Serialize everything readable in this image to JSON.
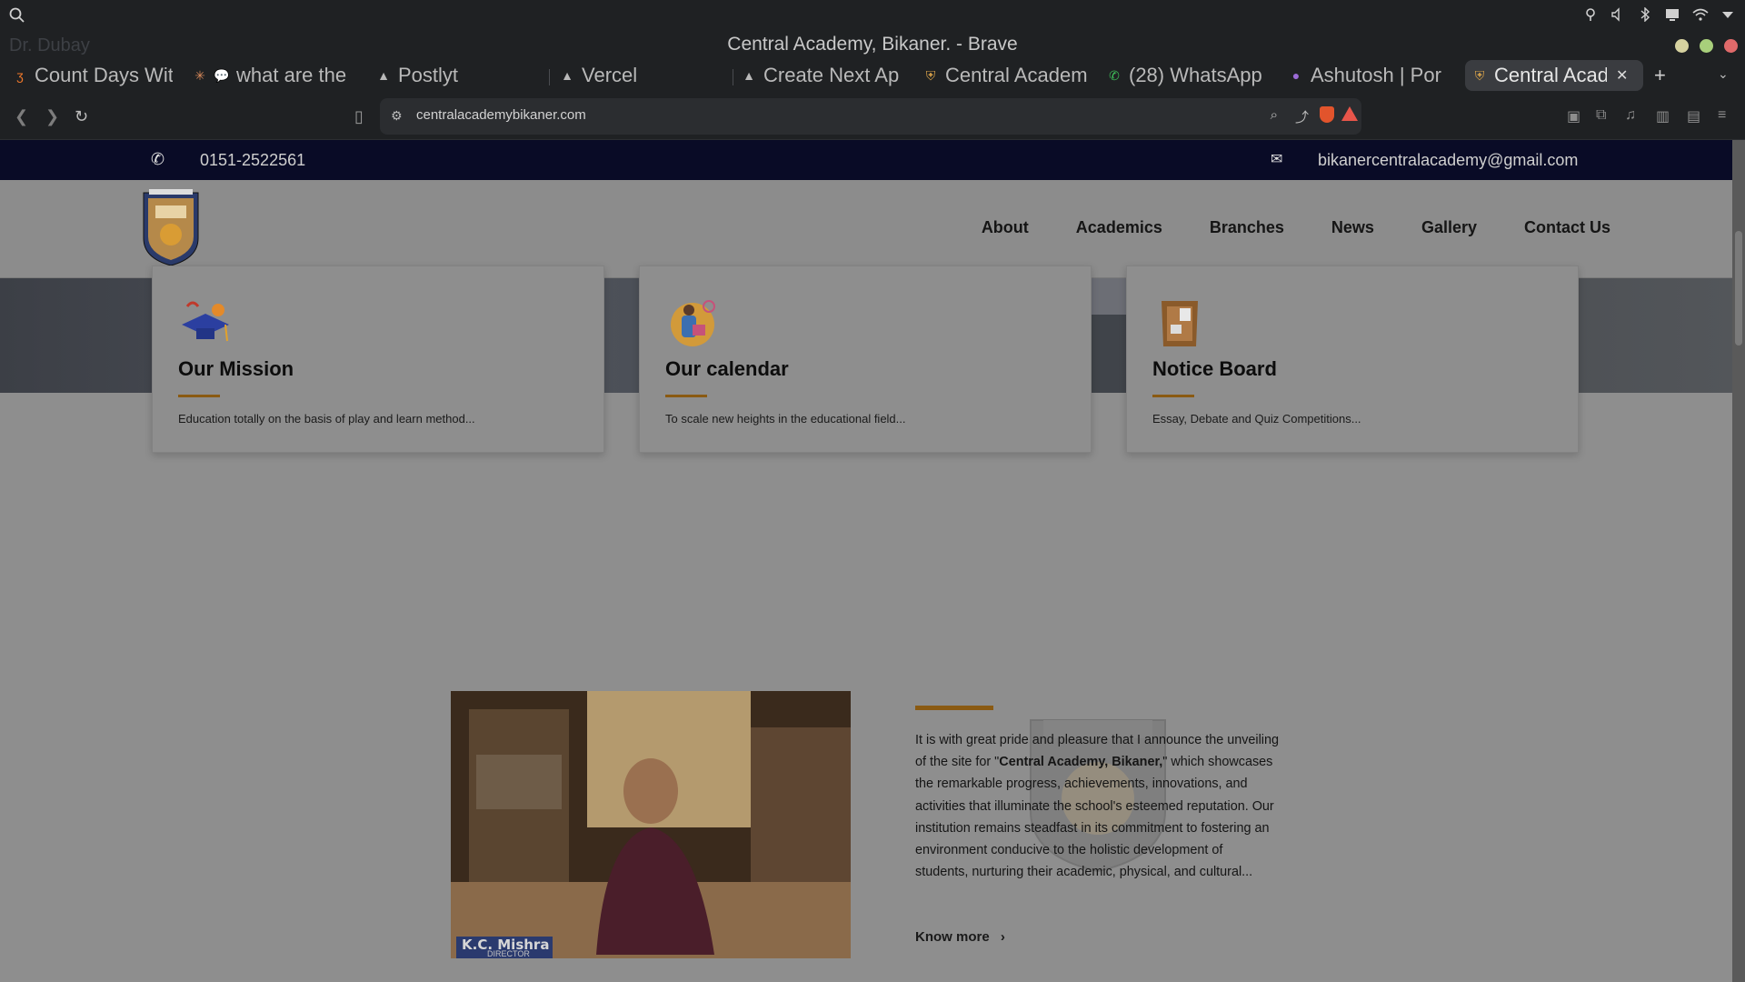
{
  "os": {
    "search_icon": "search-icon",
    "tray_icons": [
      "location-icon",
      "volume-icon",
      "bluetooth-icon",
      "display-icon",
      "wifi-icon",
      "dropdown-icon"
    ]
  },
  "window": {
    "title": "Central Academy, Bikaner. - Brave",
    "ghost_tab": "Dr. Dubay",
    "controls": [
      "#d6d2a0",
      "#a8cf7b",
      "#e06a6a"
    ]
  },
  "tabs": [
    {
      "label": "Count Days Wit",
      "icon": "brave-icon"
    },
    {
      "label": "what are the",
      "icon": "chat-icon"
    },
    {
      "label": "Postlyt",
      "icon": "vercel-icon"
    },
    {
      "label": "Vercel",
      "icon": "vercel-icon"
    },
    {
      "label": "Create Next Ap",
      "icon": "vercel-icon"
    },
    {
      "label": "Central Academ",
      "icon": "school-icon"
    },
    {
      "label": "(28) WhatsApp",
      "icon": "whatsapp-icon"
    },
    {
      "label": "Ashutosh | Por",
      "icon": "portfolio-icon"
    },
    {
      "label": "Central Acad",
      "icon": "school-icon",
      "active": true
    }
  ],
  "toolbar": {
    "url": "centralacademybikaner.com"
  },
  "site": {
    "phone": "0151-2522561",
    "email": "bikanercentralacademy@gmail.com",
    "nav": [
      "About",
      "Academics",
      "Branches",
      "News",
      "Gallery",
      "Contact Us"
    ],
    "cards": [
      {
        "title": "Our Mission",
        "text": "Education totally on the basis of play and learn method..."
      },
      {
        "title": "Our calendar",
        "text": "To scale new heights in the educational field..."
      },
      {
        "title": "Notice Board",
        "text": "Essay, Debate and Quiz Competitions..."
      }
    ],
    "director": {
      "nameplate": "K.C. Mishra",
      "role": "DIRECTOR",
      "para_1": "It is with great pride and pleasure that I announce the unveiling of the site for \"",
      "para_bold": "Central Academy, Bikaner,",
      "para_2": "\" which showcases the remarkable progress, achievements, innovations, and activities that illuminate the school's esteemed reputation. Our institution remains steadfast in its commitment to fostering an environment conducive to the holistic development of students, nurturing their academic, physical, and cultural...",
      "know_more": "Know more"
    }
  }
}
